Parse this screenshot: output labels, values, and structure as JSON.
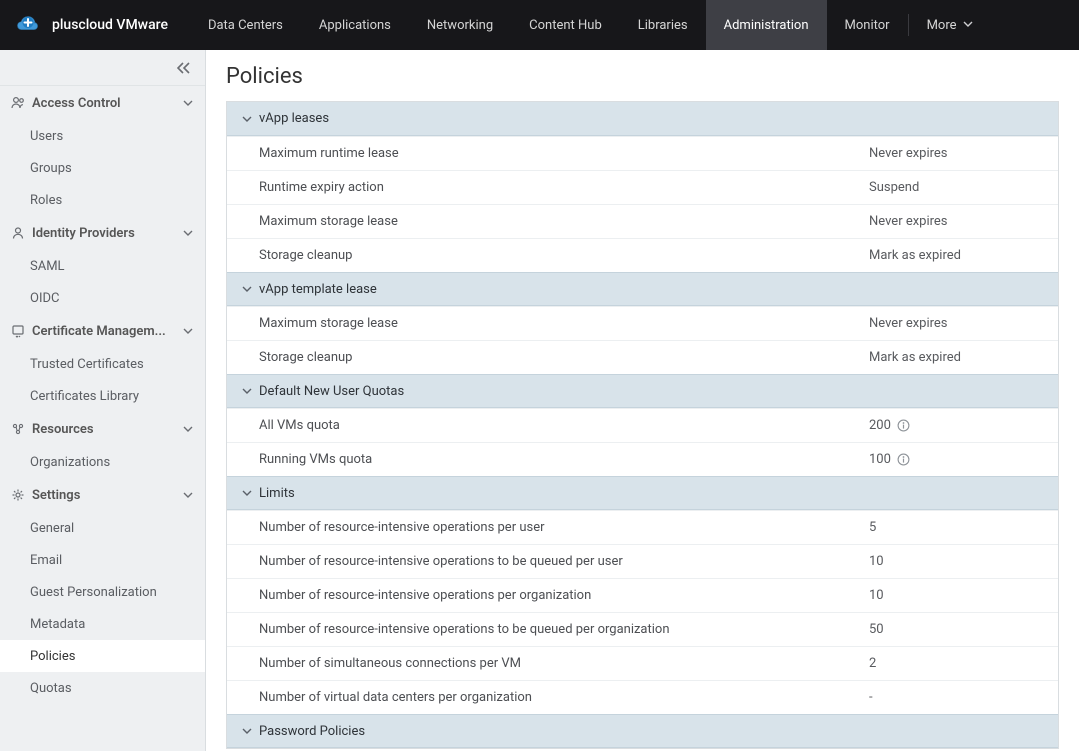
{
  "brand": {
    "text": "pluscloud VMware"
  },
  "topnav": {
    "data_centers": "Data Centers",
    "applications": "Applications",
    "networking": "Networking",
    "content_hub": "Content Hub",
    "libraries": "Libraries",
    "administration": "Administration",
    "monitor": "Monitor",
    "more": "More"
  },
  "sidebar": {
    "access_control": {
      "label": "Access Control",
      "users": "Users",
      "groups": "Groups",
      "roles": "Roles"
    },
    "identity_providers": {
      "label": "Identity Providers",
      "saml": "SAML",
      "oidc": "OIDC"
    },
    "certificate_management": {
      "label": "Certificate Managem...",
      "trusted": "Trusted Certificates",
      "library": "Certificates Library"
    },
    "resources": {
      "label": "Resources",
      "organizations": "Organizations"
    },
    "settings": {
      "label": "Settings",
      "general": "General",
      "email": "Email",
      "guest_personalization": "Guest Personalization",
      "metadata": "Metadata",
      "policies": "Policies",
      "quotas": "Quotas"
    }
  },
  "page": {
    "title": "Policies"
  },
  "sections": {
    "vapp_leases": {
      "title": "vApp leases",
      "rows": {
        "max_runtime": {
          "label": "Maximum runtime lease",
          "value": "Never expires"
        },
        "runtime_expiry": {
          "label": "Runtime expiry action",
          "value": "Suspend"
        },
        "max_storage": {
          "label": "Maximum storage lease",
          "value": "Never expires"
        },
        "storage_cleanup": {
          "label": "Storage cleanup",
          "value": "Mark as expired"
        }
      }
    },
    "vapp_template_lease": {
      "title": "vApp template lease",
      "rows": {
        "max_storage": {
          "label": "Maximum storage lease",
          "value": "Never expires"
        },
        "storage_cleanup": {
          "label": "Storage cleanup",
          "value": "Mark as expired"
        }
      }
    },
    "default_quotas": {
      "title": "Default New User Quotas",
      "rows": {
        "all_vms": {
          "label": "All VMs quota",
          "value": "200"
        },
        "running_vms": {
          "label": "Running VMs quota",
          "value": "100"
        }
      }
    },
    "limits": {
      "title": "Limits",
      "rows": {
        "ops_user": {
          "label": "Number of resource-intensive operations per user",
          "value": "5"
        },
        "queued_user": {
          "label": "Number of resource-intensive operations to be queued per user",
          "value": "10"
        },
        "ops_org": {
          "label": "Number of resource-intensive operations per organization",
          "value": "10"
        },
        "queued_org": {
          "label": "Number of resource-intensive operations to be queued per organization",
          "value": "50"
        },
        "conn_vm": {
          "label": "Number of simultaneous connections per VM",
          "value": "2"
        },
        "vdcs_org": {
          "label": "Number of virtual data centers per organization",
          "value": "-"
        }
      }
    },
    "password_policies": {
      "title": "Password Policies"
    }
  }
}
